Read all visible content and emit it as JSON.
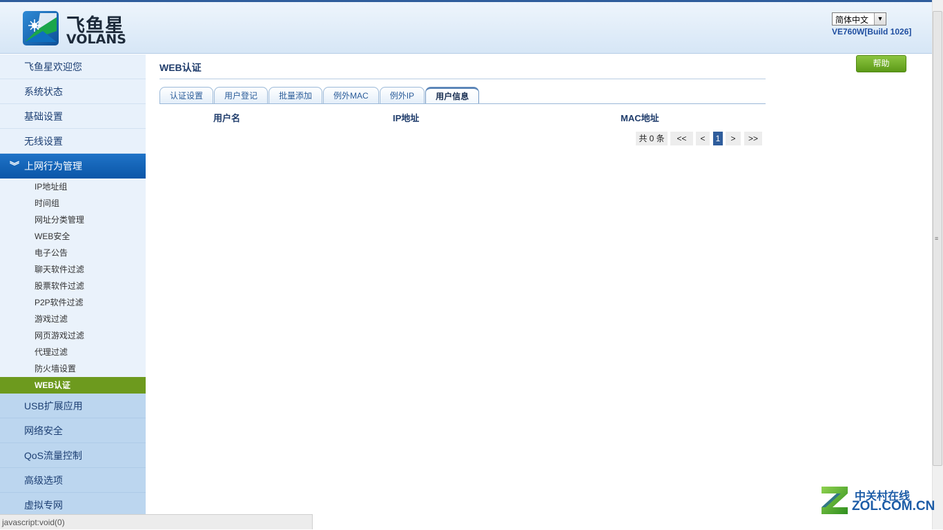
{
  "header": {
    "logo": {
      "cn": "飞鱼星",
      "en": "VOLANS"
    },
    "language": "简体中文",
    "version": "VE760W[Build 1026]"
  },
  "sidebar": {
    "top_items": [
      {
        "label": "飞鱼星欢迎您"
      },
      {
        "label": "系统状态"
      },
      {
        "label": "基础设置"
      },
      {
        "label": "无线设置"
      }
    ],
    "active_section": {
      "label": "上网行为管理"
    },
    "sub_items": [
      {
        "label": "IP地址组"
      },
      {
        "label": "时间组"
      },
      {
        "label": "网址分类管理"
      },
      {
        "label": "WEB安全"
      },
      {
        "label": "电子公告"
      },
      {
        "label": "聊天软件过滤"
      },
      {
        "label": "股票软件过滤"
      },
      {
        "label": "P2P软件过滤"
      },
      {
        "label": "游戏过滤"
      },
      {
        "label": "网页游戏过滤"
      },
      {
        "label": "代理过滤"
      },
      {
        "label": "防火墙设置"
      },
      {
        "label": "WEB认证"
      }
    ],
    "bottom_items": [
      {
        "label": "USB扩展应用"
      },
      {
        "label": "网络安全"
      },
      {
        "label": "QoS流量控制"
      },
      {
        "label": "高级选项"
      },
      {
        "label": "虚拟专网"
      }
    ]
  },
  "main": {
    "title": "WEB认证",
    "help_label": "帮助",
    "tabs": [
      {
        "label": "认证设置"
      },
      {
        "label": "用户登记"
      },
      {
        "label": "批量添加"
      },
      {
        "label": "例外MAC"
      },
      {
        "label": "例外IP"
      },
      {
        "label": "用户信息"
      }
    ],
    "active_tab": "用户信息",
    "columns": [
      "用户名",
      "IP地址",
      "MAC地址"
    ],
    "rows": [],
    "pagination": {
      "total": "共 0 条",
      "first": "<<",
      "prev": "<",
      "current": "1",
      "next": ">",
      "last": ">>"
    }
  },
  "statusbar": {
    "text": "javascript:void(0)"
  },
  "watermark": {
    "cn": "中关村在线",
    "en": "ZOL.COM.CN"
  },
  "colors": {
    "brand_blue": "#0b56a8",
    "active_green": "#6d9a1e",
    "help_green": "#5c9a18",
    "title_navy": "#1f3c6b"
  }
}
